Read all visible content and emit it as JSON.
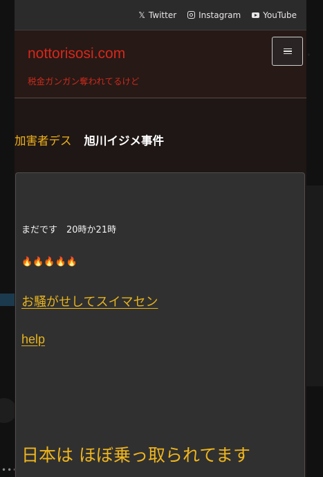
{
  "topbar": {
    "social": [
      {
        "icon": "x-icon",
        "glyph": "𝕏",
        "label": "Twitter"
      },
      {
        "icon": "instagram-icon",
        "glyph": "",
        "label": "Instagram"
      },
      {
        "icon": "youtube-icon",
        "glyph": "",
        "label": "YouTube"
      }
    ]
  },
  "header": {
    "site_title": "nottorisosi.com",
    "tagline": "税金ガンガン奪われてるけど",
    "menu_icon": "hamburger-icon"
  },
  "post": {
    "category": "加害者デス",
    "title": "旭川イジメ事件"
  },
  "card": {
    "line1": "まだです　20時か21時",
    "fires": "🔥🔥🔥🔥🔥",
    "link_apology": "お騒がせしてスイマセン",
    "link_help": "help",
    "headline": "日本は ほぼ乗っ取られてます"
  },
  "colors": {
    "site_title": "#d9271b",
    "accent_yellow": "#f0b61d",
    "card_bg": "#303030",
    "header_bg": "#261916"
  }
}
